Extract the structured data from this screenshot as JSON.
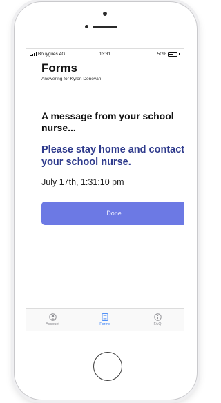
{
  "status_bar": {
    "carrier": "Bouygues 4G",
    "time": "13:31",
    "battery_percent": "50%",
    "battery_level": 0.5
  },
  "header": {
    "title": "Forms",
    "subtitle": "Answering for Kyron Donovan"
  },
  "message": {
    "heading": "A message from your school nurse...",
    "alert": "Please stay home and contact your school nurse.",
    "timestamp": "July 17th, 1:31:10 pm"
  },
  "actions": {
    "done_label": "Done"
  },
  "tabs": [
    {
      "label": "Account",
      "icon": "account-icon",
      "active": false
    },
    {
      "label": "Forms",
      "icon": "forms-icon",
      "active": true
    },
    {
      "label": "FAQ",
      "icon": "info-icon",
      "active": false
    }
  ],
  "colors": {
    "accent": "#6c79e4",
    "alert_text": "#2e3a8c",
    "active_tab": "#3b82f6",
    "inactive_tab": "#8e8e93"
  }
}
